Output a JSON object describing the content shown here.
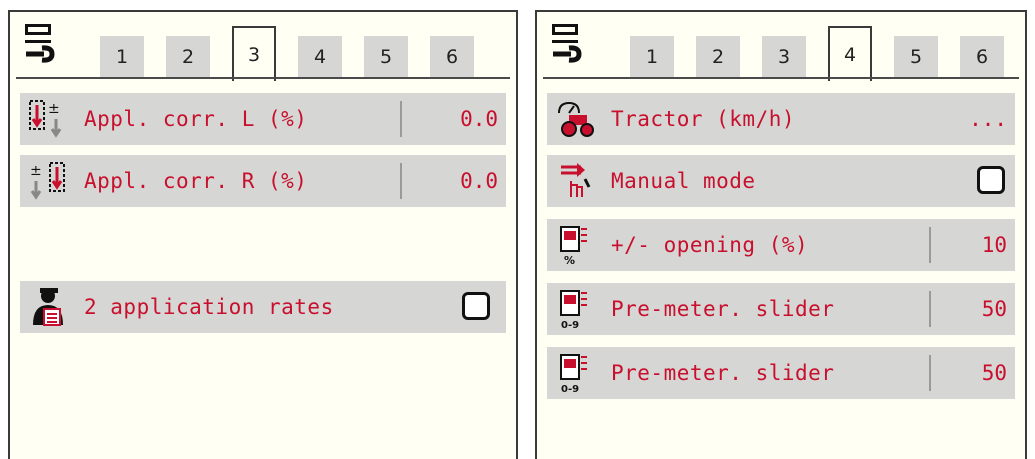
{
  "colors": {
    "label_red": "#c8102e",
    "row_gray": "#d6d6d4",
    "panel_bg": "#fffff4"
  },
  "left_panel": {
    "settings_icon": "settings-wrench-icon",
    "tabs": [
      {
        "label": "1",
        "active": false
      },
      {
        "label": "2",
        "active": false
      },
      {
        "label": "3",
        "active": true
      },
      {
        "label": "4",
        "active": false
      },
      {
        "label": "5",
        "active": false
      },
      {
        "label": "6",
        "active": false
      }
    ],
    "rows": [
      {
        "icon": "appl-corr-left-icon",
        "label": "Appl. corr. L (%)",
        "value": "0.0"
      },
      {
        "icon": "appl-corr-right-icon",
        "label": "Appl. corr. R (%)",
        "value": "0.0"
      },
      {
        "icon": "operator-rate-icon",
        "label": "2 application rates",
        "checked": false
      }
    ]
  },
  "right_panel": {
    "settings_icon": "settings-wrench-icon",
    "tabs": [
      {
        "label": "1",
        "active": false
      },
      {
        "label": "2",
        "active": false
      },
      {
        "label": "3",
        "active": false
      },
      {
        "label": "4",
        "active": true
      },
      {
        "label": "5",
        "active": false
      },
      {
        "label": "6",
        "active": false
      }
    ],
    "rows": [
      {
        "icon": "tractor-speed-icon",
        "label": "Tractor (km/h)",
        "value": "..."
      },
      {
        "icon": "manual-mode-icon",
        "label": "Manual mode",
        "checked": false
      },
      {
        "icon": "opening-percent-icon",
        "label": "+/- opening (%)",
        "value": "10"
      },
      {
        "icon": "pre-meter-slider-icon",
        "label": "Pre-meter. slider",
        "value": "50",
        "icon_sub": "0-9"
      },
      {
        "icon": "pre-meter-slider-icon",
        "label": "Pre-meter. slider",
        "value": "50",
        "icon_sub": "0-9"
      }
    ]
  }
}
